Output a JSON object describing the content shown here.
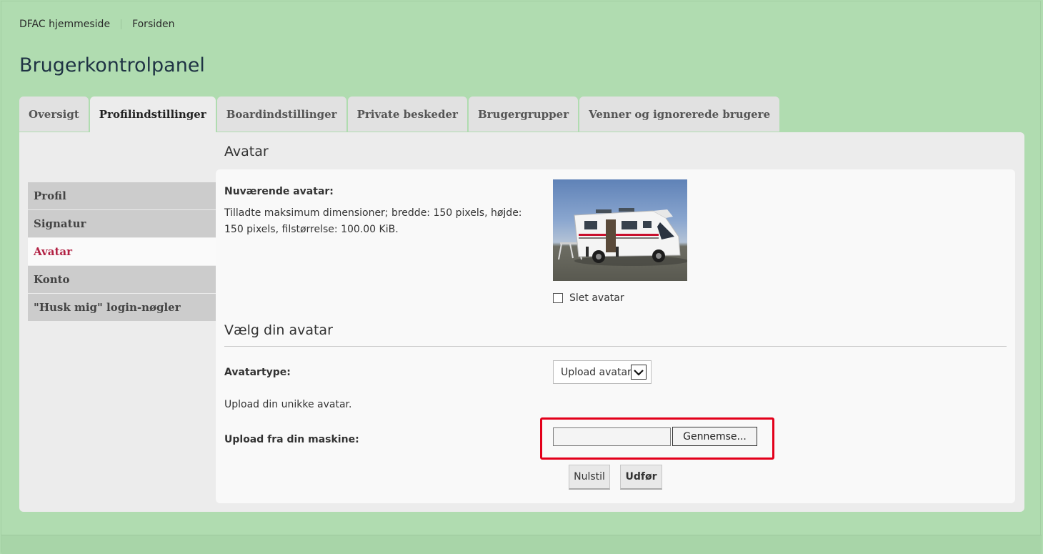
{
  "breadcrumb": {
    "home": "DFAC hjemmeside",
    "index": "Forsiden"
  },
  "page_title": "Brugerkontrolpanel",
  "tabs": [
    {
      "label": "Oversigt",
      "active": false
    },
    {
      "label": "Profilindstillinger",
      "active": true
    },
    {
      "label": "Boardindstillinger",
      "active": false
    },
    {
      "label": "Private beskeder",
      "active": false
    },
    {
      "label": "Brugergrupper",
      "active": false
    },
    {
      "label": "Venner og ignorerede brugere",
      "active": false
    }
  ],
  "sidebar": {
    "items": [
      {
        "label": "Profil",
        "active": false
      },
      {
        "label": "Signatur",
        "active": false
      },
      {
        "label": "Avatar",
        "active": true
      },
      {
        "label": "Konto",
        "active": false
      },
      {
        "label": "\"Husk mig\" login-nøgler",
        "active": false
      }
    ]
  },
  "avatar": {
    "section_title": "Avatar",
    "current_label": "Nuværende avatar:",
    "dimensions_text": "Tilladte maksimum dimensioner; bredde: 150 pixels, højde: 150 pixels, filstørrelse: 100.00 KiB.",
    "delete_label": "Slet avatar"
  },
  "choose": {
    "section_title": "Vælg din avatar",
    "type_label": "Avatartype:",
    "type_selected": "Upload avatar",
    "upload_hint": "Upload din unikke avatar.",
    "upload_label": "Upload fra din maskine:",
    "browse_label": "Gennemse...",
    "reset_label": "Nulstil",
    "submit_label": "Udfør"
  },
  "colors": {
    "background": "#b0dcb0",
    "panel": "#ececec",
    "active_menu_text": "#b22244",
    "highlight": "#e3001b"
  }
}
